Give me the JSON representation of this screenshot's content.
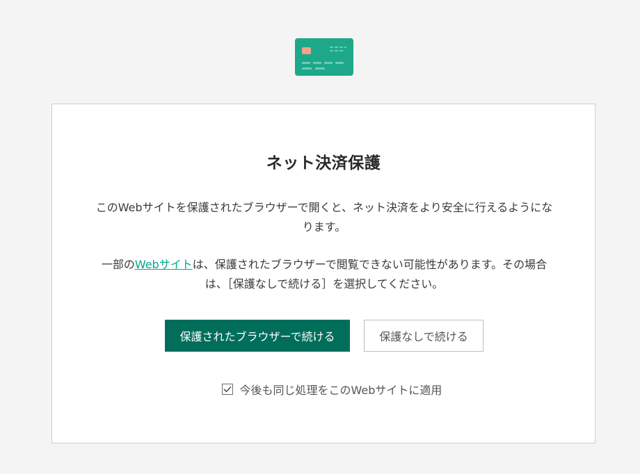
{
  "icon": {
    "name": "credit-card-icon",
    "color": "#1ea88a",
    "chip_color": "#f1a48a"
  },
  "dialog": {
    "title": "ネット決済保護",
    "paragraph1": "このWebサイトを保護されたブラウザーで開くと、ネット決済をより安全に行えるようになります。",
    "paragraph2_before": "一部の",
    "paragraph2_link": "Webサイト",
    "paragraph2_after": "は、保護されたブラウザーで閲覧できない可能性があります。その場合は、［保護なしで続ける］を選択してください。",
    "primary_button": "保護されたブラウザーで続ける",
    "secondary_button": "保護なしで続ける",
    "checkbox_label": "今後も同じ処理をこのWebサイトに適用",
    "checkbox_checked": true
  },
  "colors": {
    "primary": "#006e5b",
    "link": "#00a88a",
    "background": "#f4f4f4"
  }
}
